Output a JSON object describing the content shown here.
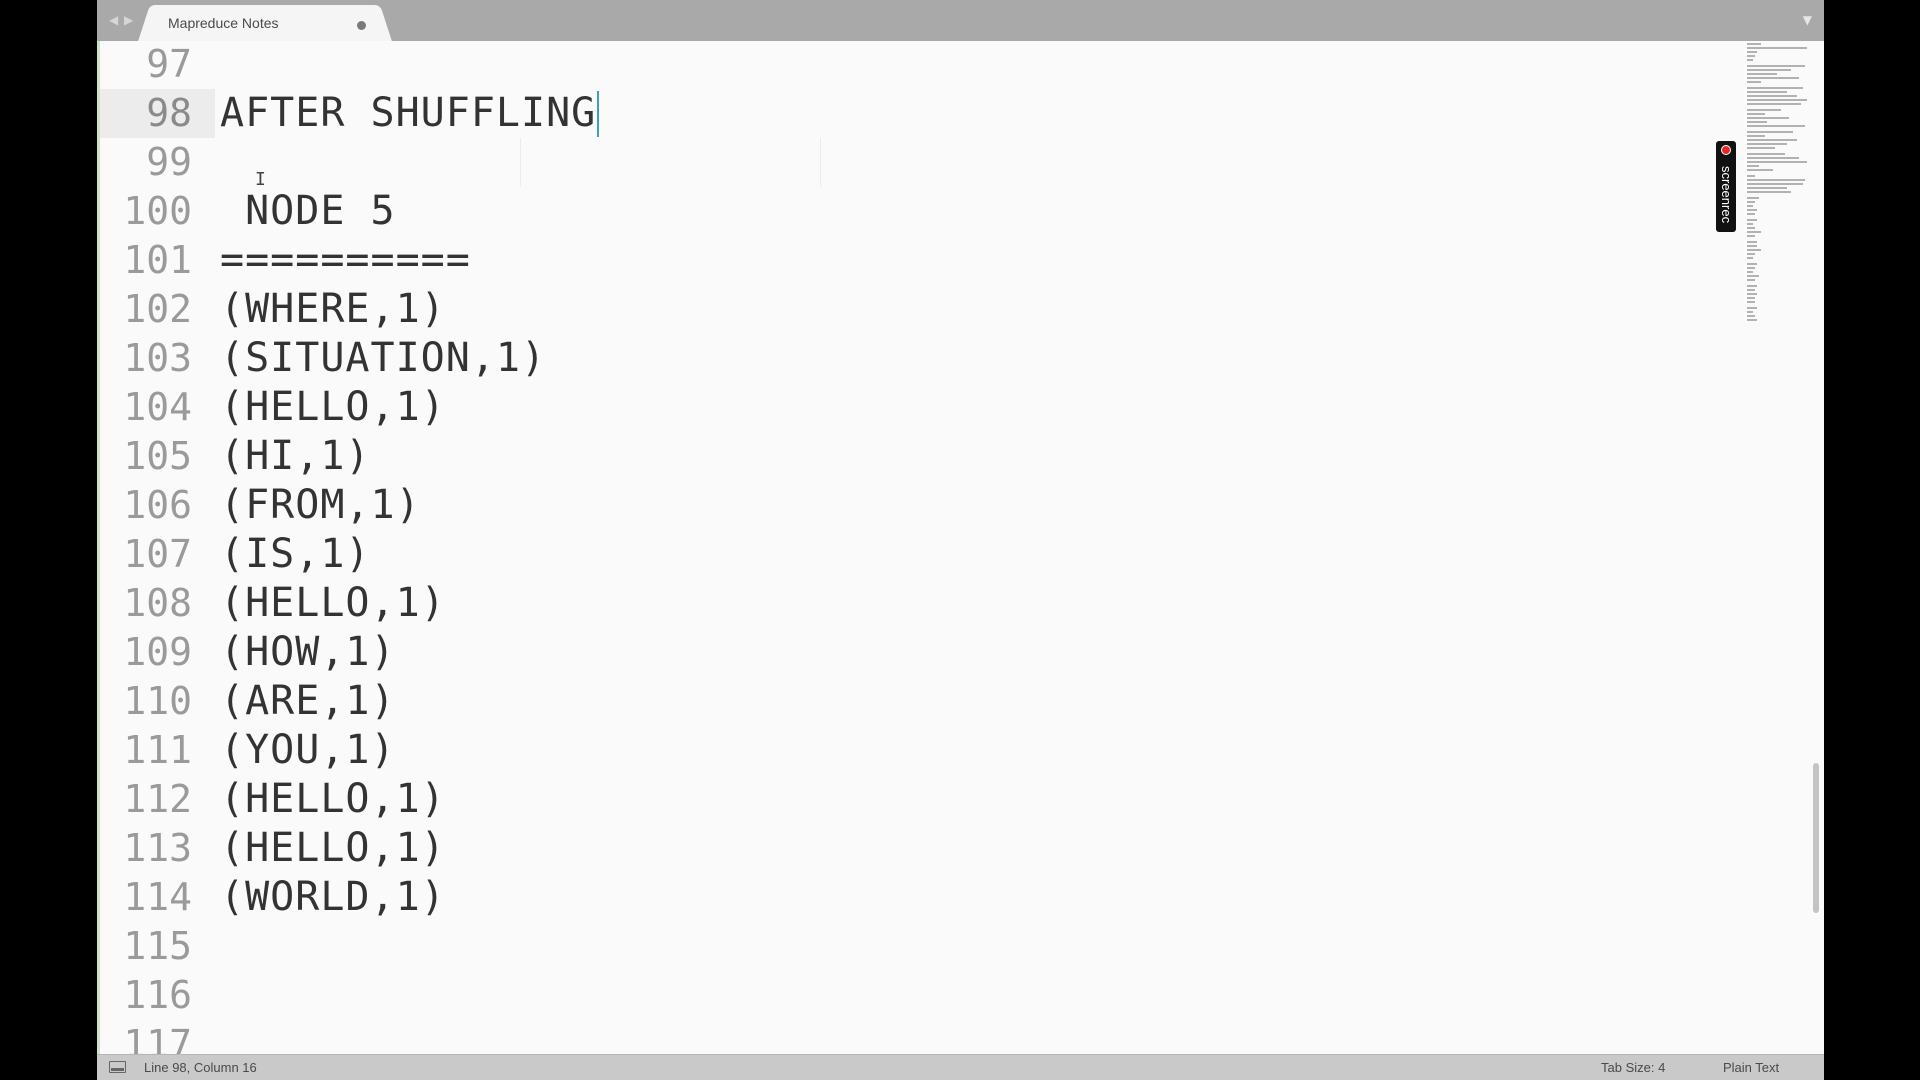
{
  "tab": {
    "title": "Mapreduce Notes",
    "unsaved": true
  },
  "nav": {
    "back_icon": "◀",
    "forward_icon": "▶",
    "dropdown_icon": "▼"
  },
  "editor": {
    "lines": [
      {
        "number": "97",
        "text": ""
      },
      {
        "number": "98",
        "text": "AFTER SHUFFLING",
        "active": true
      },
      {
        "number": "99",
        "text": ""
      },
      {
        "number": "100",
        "text": " NODE 5"
      },
      {
        "number": "101",
        "text": "=========="
      },
      {
        "number": "102",
        "text": "(WHERE,1)"
      },
      {
        "number": "103",
        "text": "(SITUATION,1)"
      },
      {
        "number": "104",
        "text": "(HELLO,1)"
      },
      {
        "number": "105",
        "text": "(HI,1)"
      },
      {
        "number": "106",
        "text": "(FROM,1)"
      },
      {
        "number": "107",
        "text": "(IS,1)"
      },
      {
        "number": "108",
        "text": "(HELLO,1)"
      },
      {
        "number": "109",
        "text": "(HOW,1)"
      },
      {
        "number": "110",
        "text": "(ARE,1)"
      },
      {
        "number": "111",
        "text": "(YOU,1)"
      },
      {
        "number": "112",
        "text": "(HELLO,1)"
      },
      {
        "number": "113",
        "text": "(HELLO,1)"
      },
      {
        "number": "114",
        "text": "(WORLD,1)"
      },
      {
        "number": "115",
        "text": ""
      },
      {
        "number": "116",
        "text": ""
      },
      {
        "number": "117",
        "text": ""
      }
    ]
  },
  "overlay": {
    "recorder_label": "screenrec"
  },
  "status": {
    "position": "Line 98, Column 16",
    "tab_size": "Tab Size: 4",
    "syntax": "Plain Text"
  },
  "colors": {
    "caret": "#3aa3b3",
    "tabbar": "#a9a9a9",
    "statusbar": "#c9c9c9"
  }
}
